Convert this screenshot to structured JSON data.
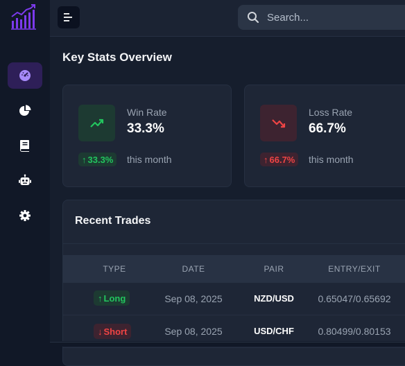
{
  "search": {
    "placeholder": "Search..."
  },
  "sidebar": {
    "items": [
      {
        "name": "dashboard",
        "icon": "gauge-icon",
        "active": true
      },
      {
        "name": "analytics",
        "icon": "pie-chart-icon",
        "active": false
      },
      {
        "name": "journal",
        "icon": "book-icon",
        "active": false
      },
      {
        "name": "bot",
        "icon": "robot-icon",
        "active": false
      },
      {
        "name": "settings",
        "icon": "gear-icon",
        "active": false
      }
    ]
  },
  "page": {
    "title": "Key Stats Overview"
  },
  "stats": [
    {
      "label": "Win Rate",
      "value": "33.3%",
      "change": "33.3%",
      "change_note": "this month",
      "icon": "trend-up-icon",
      "color": "#22c55e"
    },
    {
      "label": "Loss Rate",
      "value": "66.7%",
      "change": "66.7%",
      "change_note": "this month",
      "icon": "trend-down-icon",
      "color": "#ef4444"
    }
  ],
  "trades": {
    "title": "Recent Trades",
    "columns": [
      "TYPE",
      "DATE",
      "PAIR",
      "ENTRY/EXIT"
    ],
    "rows": [
      {
        "type": "Long",
        "date": "Sep 08, 2025",
        "pair": "NZD/USD",
        "entry_exit": "0.65047/0.65692"
      },
      {
        "type": "Short",
        "date": "Sep 08, 2025",
        "pair": "USD/CHF",
        "entry_exit": "0.80499/0.80153"
      }
    ]
  },
  "colors": {
    "accent": "#8b5cf6",
    "positive": "#22c55e",
    "negative": "#ef4444",
    "background": "#161e2d",
    "card": "#1e2636"
  }
}
